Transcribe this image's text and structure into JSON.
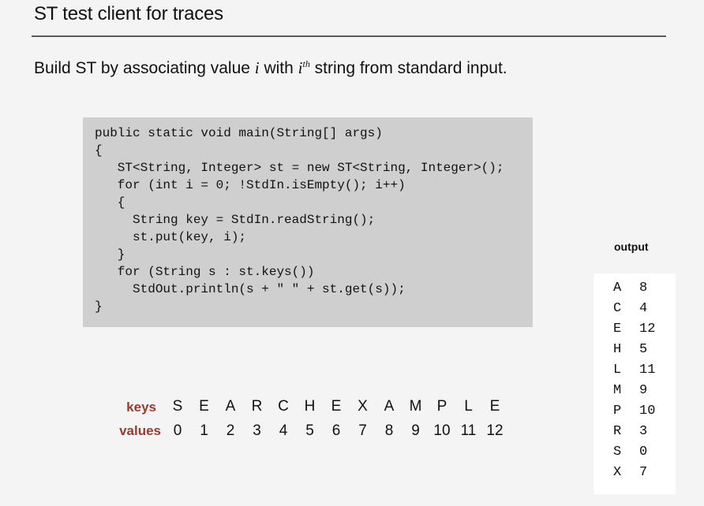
{
  "title": "ST test client for traces",
  "subtitle": {
    "prefix": "Build ST by associating value ",
    "var": "i",
    "mid": " with ",
    "ordinal_var": "i",
    "ordinal_suffix": "th",
    "suffix": " string from standard input."
  },
  "code_lines": [
    "public static void main(String[] args)",
    "{",
    "   ST<String, Integer> st = new ST<String, Integer>();",
    "   for (int i = 0; !StdIn.isEmpty(); i++)",
    "   {",
    "     String key = StdIn.readString();",
    "     st.put(key, i);",
    "   }",
    "   for (String s : st.keys())",
    "     StdOut.println(s + \" \" + st.get(s));",
    "}"
  ],
  "output": {
    "label": "output",
    "rows": [
      {
        "key": "A",
        "value": "8"
      },
      {
        "key": "C",
        "value": "4"
      },
      {
        "key": "E",
        "value": "12"
      },
      {
        "key": "H",
        "value": "5"
      },
      {
        "key": "L",
        "value": "11"
      },
      {
        "key": "M",
        "value": "9"
      },
      {
        "key": "P",
        "value": "10"
      },
      {
        "key": "R",
        "value": "3"
      },
      {
        "key": "S",
        "value": "0"
      },
      {
        "key": "X",
        "value": "7"
      }
    ]
  },
  "trace": {
    "keys_label": "keys",
    "values_label": "values",
    "keys": [
      "S",
      "E",
      "A",
      "R",
      "C",
      "H",
      "E",
      "X",
      "A",
      "M",
      "P",
      "L",
      "E"
    ],
    "values": [
      "0",
      "1",
      "2",
      "3",
      "4",
      "5",
      "6",
      "7",
      "8",
      "9",
      "10",
      "11",
      "12"
    ]
  },
  "colors": {
    "label_accent": "#9b3a2c",
    "code_background": "#cfcfcf",
    "page_background": "#f4f4f4"
  }
}
